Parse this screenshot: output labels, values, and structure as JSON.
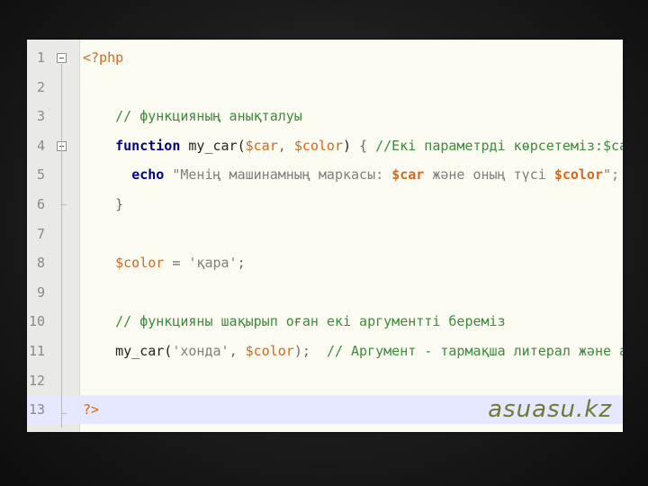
{
  "lines": [
    {
      "n": "1",
      "parts": [
        [
          "php",
          "<?php"
        ]
      ]
    },
    {
      "n": "2",
      "parts": []
    },
    {
      "n": "3",
      "parts": [
        [
          "cm",
          "    // функцияның анықталуы"
        ]
      ]
    },
    {
      "n": "4",
      "parts": [
        [
          "fn",
          "    "
        ],
        [
          "kw",
          "function"
        ],
        [
          "fn",
          " my_car("
        ],
        [
          "var",
          "$car"
        ],
        [
          "pn",
          ", "
        ],
        [
          "var",
          "$color"
        ],
        [
          "fn",
          ") "
        ],
        [
          "pn",
          "{ "
        ],
        [
          "cm",
          "//Екі параметрді көрсетеміз:$car и $color"
        ]
      ]
    },
    {
      "n": "5",
      "parts": [
        [
          "fn",
          "      "
        ],
        [
          "kw",
          "echo"
        ],
        [
          "str",
          " \"Менің машинамның маркасы: "
        ],
        [
          "strb",
          "$car"
        ],
        [
          "str",
          " және оның түсі "
        ],
        [
          "strb",
          "$color"
        ],
        [
          "str",
          "\";"
        ]
      ]
    },
    {
      "n": "6",
      "parts": [
        [
          "pn",
          "    }"
        ]
      ]
    },
    {
      "n": "7",
      "parts": []
    },
    {
      "n": "8",
      "parts": [
        [
          "fn",
          "    "
        ],
        [
          "var",
          "$color"
        ],
        [
          "pn",
          " = "
        ],
        [
          "str",
          "'қара'"
        ],
        [
          "pn",
          ";"
        ]
      ]
    },
    {
      "n": "9",
      "parts": []
    },
    {
      "n": "10",
      "parts": [
        [
          "cm",
          "    // функцияны шақырып оған екі аргументті беремiз"
        ]
      ]
    },
    {
      "n": "11",
      "parts": [
        [
          "fn",
          "    my_car("
        ],
        [
          "str",
          "'хонда'"
        ],
        [
          "pn",
          ", "
        ],
        [
          "var",
          "$color"
        ],
        [
          "pn",
          ");  "
        ],
        [
          "cm",
          "// Аргумент - тармақша литерал және айнымалы"
        ]
      ]
    },
    {
      "n": "12",
      "parts": []
    },
    {
      "n": "13",
      "parts": [
        [
          "php",
          "?>"
        ]
      ]
    }
  ],
  "watermark": "asuasu.kz"
}
